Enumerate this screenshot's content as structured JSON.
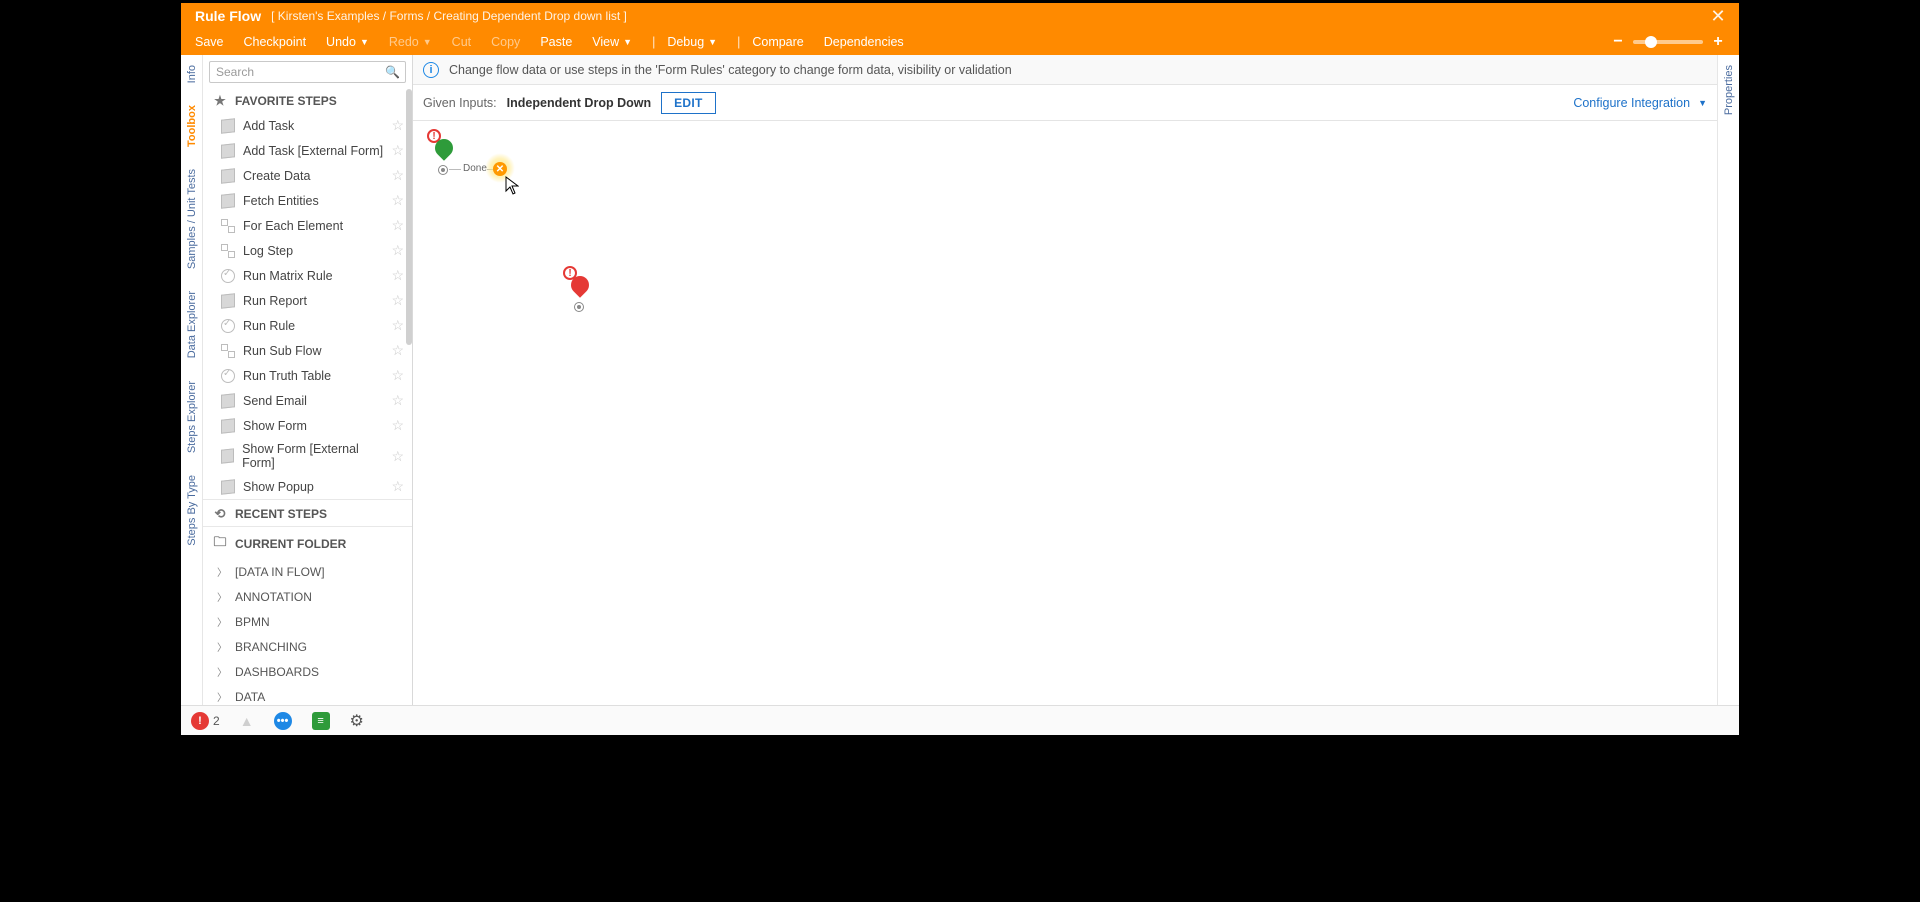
{
  "header": {
    "title": "Rule Flow",
    "breadcrumb": "[ Kirsten's Examples / Forms / Creating Dependent Drop down list ]",
    "menu": {
      "save": "Save",
      "checkpoint": "Checkpoint",
      "undo": "Undo",
      "redo": "Redo",
      "cut": "Cut",
      "copy": "Copy",
      "paste": "Paste",
      "view": "View",
      "debug": "Debug",
      "compare": "Compare",
      "dependencies": "Dependencies"
    }
  },
  "left_tabs": [
    "Info",
    "Toolbox",
    "Samples / Unit Tests",
    "Data Explorer",
    "Steps Explorer",
    "Steps By Type"
  ],
  "right_tabs": [
    "Properties"
  ],
  "search": {
    "placeholder": "Search"
  },
  "sidebar": {
    "favorite_label": "FAVORITE STEPS",
    "recent_label": "RECENT STEPS",
    "current_folder_label": "CURRENT FOLDER",
    "steps": [
      "Add Task",
      "Add Task [External Form]",
      "Create Data",
      "Fetch Entities",
      "For Each Element",
      "Log Step",
      "Run Matrix Rule",
      "Run Report",
      "Run Rule",
      "Run Sub Flow",
      "Run Truth Table",
      "Send Email",
      "Show Form",
      "Show Form [External Form]",
      "Show Popup"
    ],
    "categories": [
      "[DATA IN FLOW]",
      "ANNOTATION",
      "BPMN",
      "BRANCHING",
      "DASHBOARDS",
      "DATA"
    ]
  },
  "notice": "Change flow data or use steps in the 'Form Rules' category to change form data, visibility or validation",
  "inputs_bar": {
    "label": "Given Inputs:",
    "value": "Independent Drop Down",
    "edit": "EDIT",
    "configure": "Configure Integration"
  },
  "canvas": {
    "done_label": "Done"
  },
  "status": {
    "errors": "2"
  }
}
